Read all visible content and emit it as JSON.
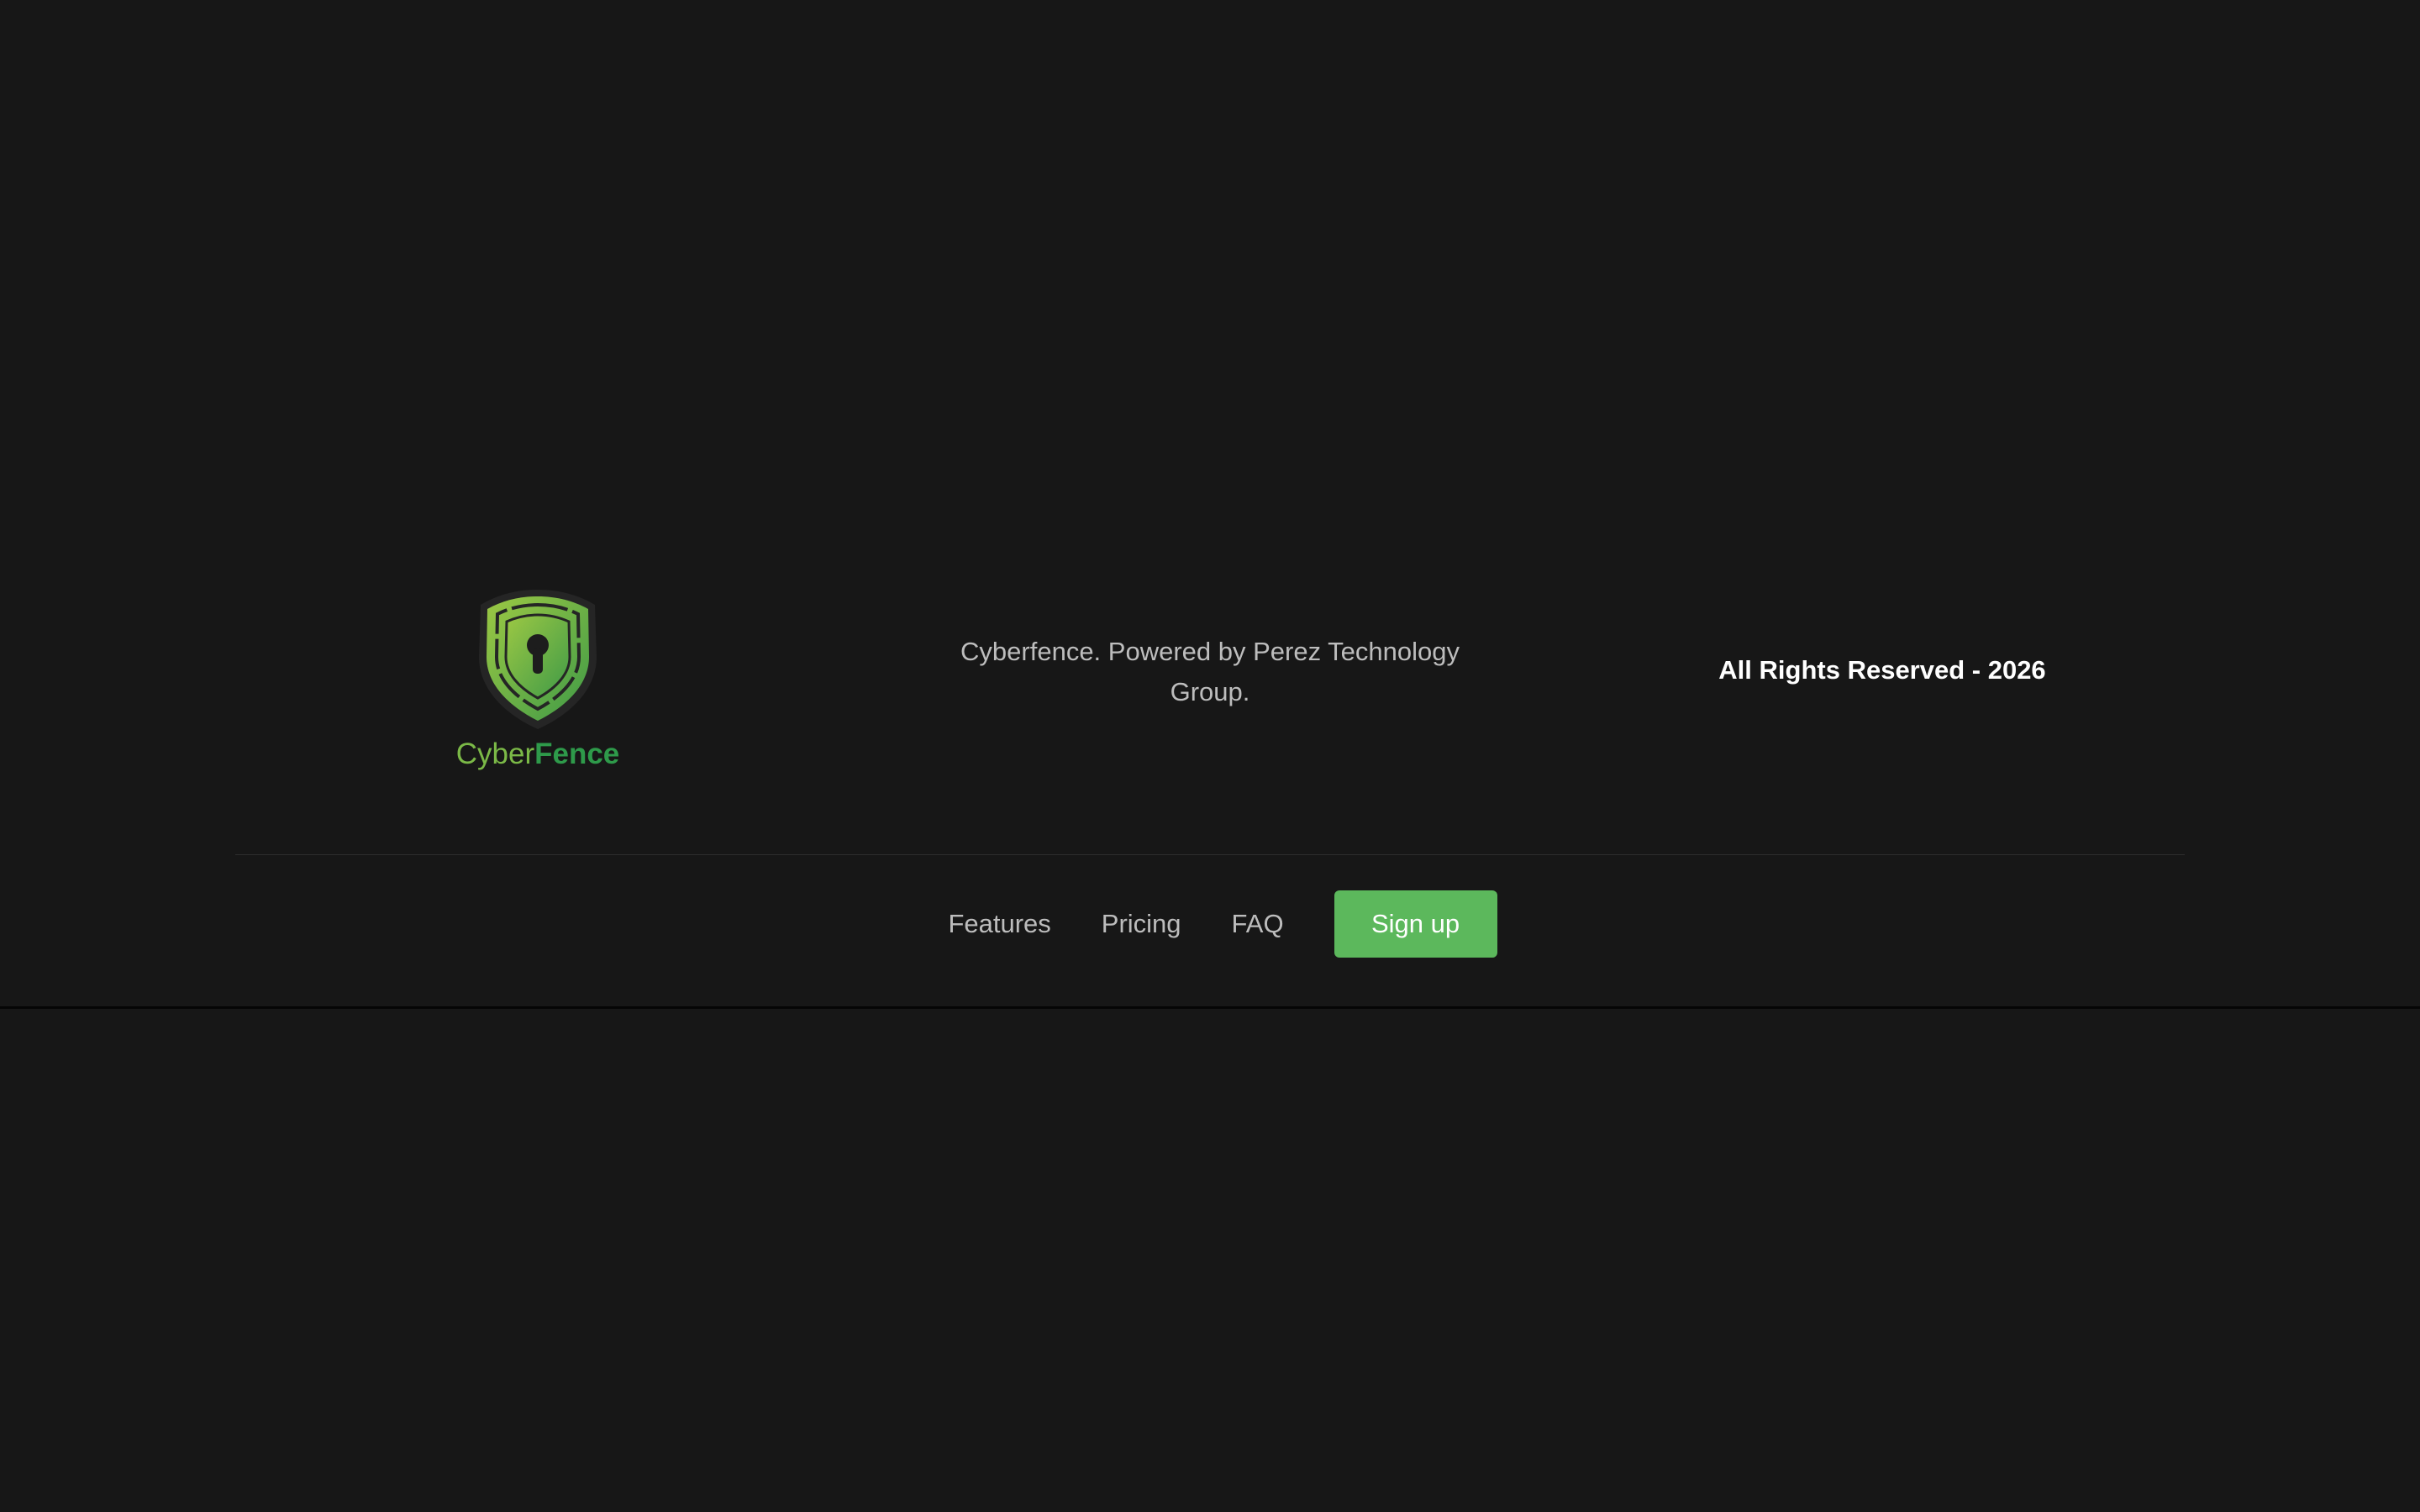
{
  "brand": {
    "name_part1": "Cyber",
    "name_part2": "Fence",
    "logo_icon": "shield-keyhole-icon",
    "color_primary": "#7bb947",
    "color_secondary": "#2e9a4a"
  },
  "footer": {
    "tagline": "Cyberfence. Powered by Perez Technology Group.",
    "rights": "All Rights Reserved - 2026"
  },
  "nav": {
    "features": "Features",
    "pricing": "Pricing",
    "faq": "FAQ",
    "signup": "Sign up",
    "signup_color": "#5cb85c"
  },
  "theme": {
    "background": "#171717"
  }
}
